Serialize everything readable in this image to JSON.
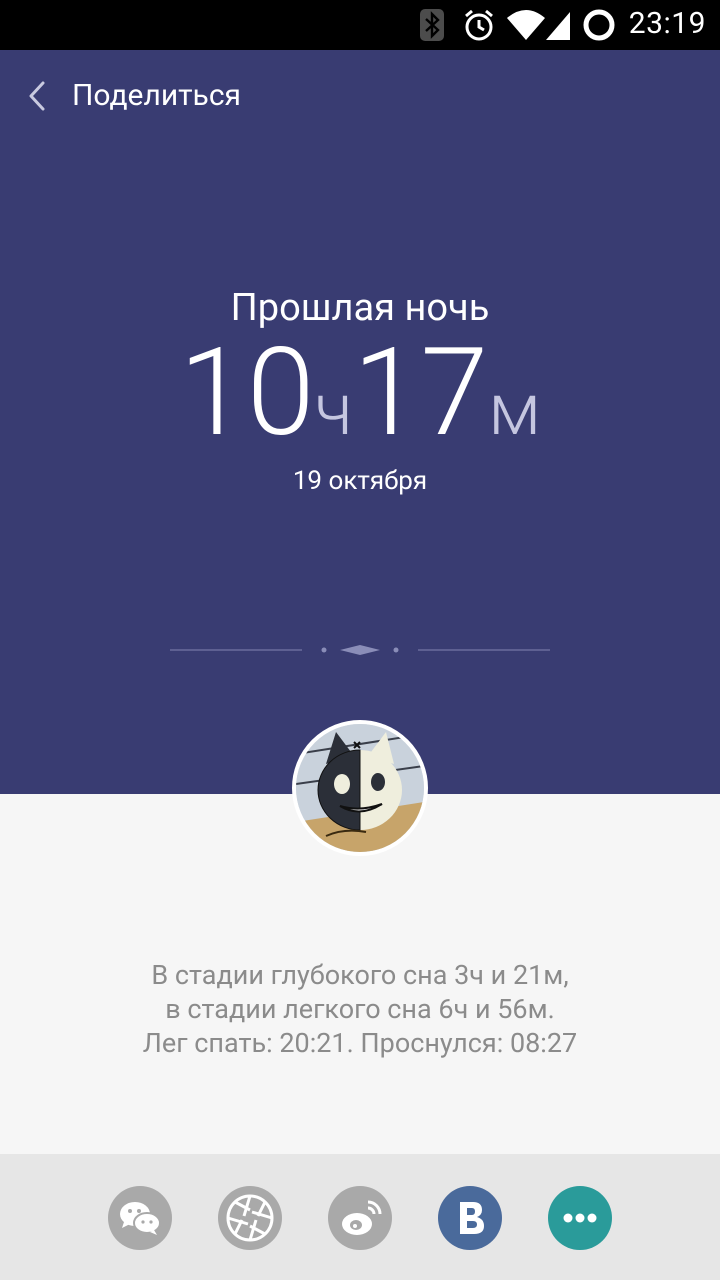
{
  "status_bar": {
    "time": "23:19",
    "icons": [
      "bluetooth-icon",
      "alarm-icon",
      "wifi-icon",
      "cell-signal-icon",
      "battery-ring-icon"
    ]
  },
  "app_bar": {
    "title": "Поделиться",
    "back_icon": "chevron-left-icon"
  },
  "sleep": {
    "period_label": "Прошлая ночь",
    "hours": "10",
    "hours_unit": "ч",
    "minutes": "17",
    "minutes_unit": "м",
    "date": "19 октября"
  },
  "summary": {
    "line1": "В стадии глубокого сна 3ч и 21м,",
    "line2": "в стадии легкого сна 6ч и 56м.",
    "line3": "Лег спать: 20:21. Проснулся: 08:27"
  },
  "share_targets": [
    {
      "icon": "wechat-icon",
      "color": "#a9a9a9"
    },
    {
      "icon": "aperture-icon",
      "color": "#a9a9a9"
    },
    {
      "icon": "weibo-icon",
      "color": "#a9a9a9"
    },
    {
      "icon": "vk-icon",
      "color": "#4a6a9b"
    },
    {
      "icon": "more-icon",
      "color": "#2a9b9a"
    }
  ],
  "colors": {
    "hero_bg": "#393c72",
    "body_bg": "#f6f6f6",
    "share_bar_bg": "#e6e6e6",
    "summary_text": "#8b8b8b"
  }
}
